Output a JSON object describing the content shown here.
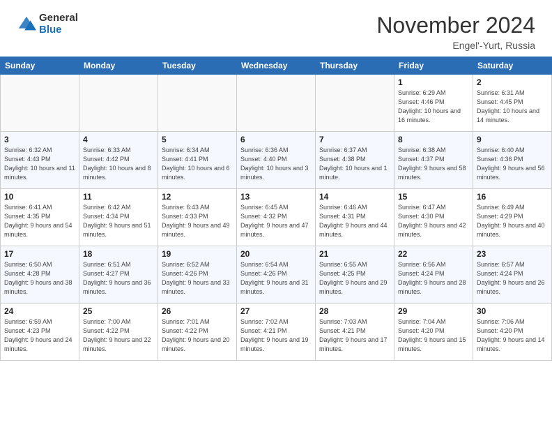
{
  "header": {
    "logo": {
      "general": "General",
      "blue": "Blue"
    },
    "title": "November 2024",
    "location": "Engel'-Yurt, Russia"
  },
  "weekdays": [
    "Sunday",
    "Monday",
    "Tuesday",
    "Wednesday",
    "Thursday",
    "Friday",
    "Saturday"
  ],
  "weeks": [
    [
      {
        "day": "",
        "empty": true
      },
      {
        "day": "",
        "empty": true
      },
      {
        "day": "",
        "empty": true
      },
      {
        "day": "",
        "empty": true
      },
      {
        "day": "",
        "empty": true
      },
      {
        "day": "1",
        "sunrise": "6:29 AM",
        "sunset": "4:46 PM",
        "daylight": "10 hours and 16 minutes."
      },
      {
        "day": "2",
        "sunrise": "6:31 AM",
        "sunset": "4:45 PM",
        "daylight": "10 hours and 14 minutes."
      }
    ],
    [
      {
        "day": "3",
        "sunrise": "6:32 AM",
        "sunset": "4:43 PM",
        "daylight": "10 hours and 11 minutes."
      },
      {
        "day": "4",
        "sunrise": "6:33 AM",
        "sunset": "4:42 PM",
        "daylight": "10 hours and 8 minutes."
      },
      {
        "day": "5",
        "sunrise": "6:34 AM",
        "sunset": "4:41 PM",
        "daylight": "10 hours and 6 minutes."
      },
      {
        "day": "6",
        "sunrise": "6:36 AM",
        "sunset": "4:40 PM",
        "daylight": "10 hours and 3 minutes."
      },
      {
        "day": "7",
        "sunrise": "6:37 AM",
        "sunset": "4:38 PM",
        "daylight": "10 hours and 1 minute."
      },
      {
        "day": "8",
        "sunrise": "6:38 AM",
        "sunset": "4:37 PM",
        "daylight": "9 hours and 58 minutes."
      },
      {
        "day": "9",
        "sunrise": "6:40 AM",
        "sunset": "4:36 PM",
        "daylight": "9 hours and 56 minutes."
      }
    ],
    [
      {
        "day": "10",
        "sunrise": "6:41 AM",
        "sunset": "4:35 PM",
        "daylight": "9 hours and 54 minutes."
      },
      {
        "day": "11",
        "sunrise": "6:42 AM",
        "sunset": "4:34 PM",
        "daylight": "9 hours and 51 minutes."
      },
      {
        "day": "12",
        "sunrise": "6:43 AM",
        "sunset": "4:33 PM",
        "daylight": "9 hours and 49 minutes."
      },
      {
        "day": "13",
        "sunrise": "6:45 AM",
        "sunset": "4:32 PM",
        "daylight": "9 hours and 47 minutes."
      },
      {
        "day": "14",
        "sunrise": "6:46 AM",
        "sunset": "4:31 PM",
        "daylight": "9 hours and 44 minutes."
      },
      {
        "day": "15",
        "sunrise": "6:47 AM",
        "sunset": "4:30 PM",
        "daylight": "9 hours and 42 minutes."
      },
      {
        "day": "16",
        "sunrise": "6:49 AM",
        "sunset": "4:29 PM",
        "daylight": "9 hours and 40 minutes."
      }
    ],
    [
      {
        "day": "17",
        "sunrise": "6:50 AM",
        "sunset": "4:28 PM",
        "daylight": "9 hours and 38 minutes."
      },
      {
        "day": "18",
        "sunrise": "6:51 AM",
        "sunset": "4:27 PM",
        "daylight": "9 hours and 36 minutes."
      },
      {
        "day": "19",
        "sunrise": "6:52 AM",
        "sunset": "4:26 PM",
        "daylight": "9 hours and 33 minutes."
      },
      {
        "day": "20",
        "sunrise": "6:54 AM",
        "sunset": "4:26 PM",
        "daylight": "9 hours and 31 minutes."
      },
      {
        "day": "21",
        "sunrise": "6:55 AM",
        "sunset": "4:25 PM",
        "daylight": "9 hours and 29 minutes."
      },
      {
        "day": "22",
        "sunrise": "6:56 AM",
        "sunset": "4:24 PM",
        "daylight": "9 hours and 28 minutes."
      },
      {
        "day": "23",
        "sunrise": "6:57 AM",
        "sunset": "4:24 PM",
        "daylight": "9 hours and 26 minutes."
      }
    ],
    [
      {
        "day": "24",
        "sunrise": "6:59 AM",
        "sunset": "4:23 PM",
        "daylight": "9 hours and 24 minutes."
      },
      {
        "day": "25",
        "sunrise": "7:00 AM",
        "sunset": "4:22 PM",
        "daylight": "9 hours and 22 minutes."
      },
      {
        "day": "26",
        "sunrise": "7:01 AM",
        "sunset": "4:22 PM",
        "daylight": "9 hours and 20 minutes."
      },
      {
        "day": "27",
        "sunrise": "7:02 AM",
        "sunset": "4:21 PM",
        "daylight": "9 hours and 19 minutes."
      },
      {
        "day": "28",
        "sunrise": "7:03 AM",
        "sunset": "4:21 PM",
        "daylight": "9 hours and 17 minutes."
      },
      {
        "day": "29",
        "sunrise": "7:04 AM",
        "sunset": "4:20 PM",
        "daylight": "9 hours and 15 minutes."
      },
      {
        "day": "30",
        "sunrise": "7:06 AM",
        "sunset": "4:20 PM",
        "daylight": "9 hours and 14 minutes."
      }
    ]
  ]
}
